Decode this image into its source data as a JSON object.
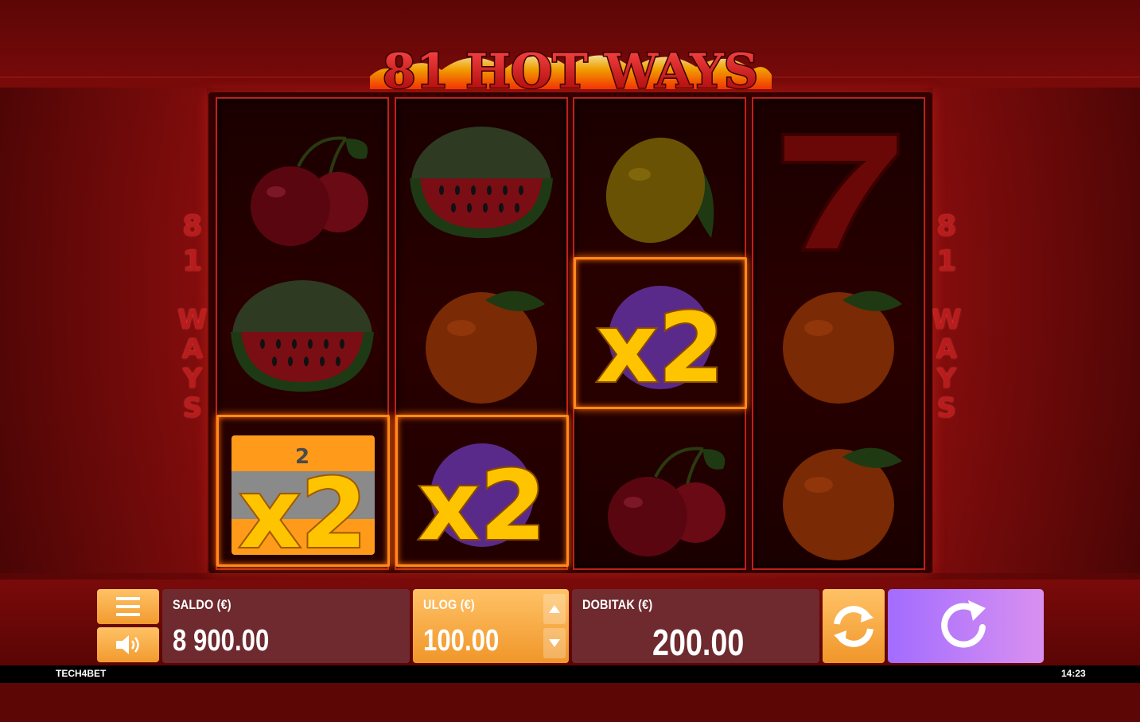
{
  "game": {
    "title": "81 HOT WAYS",
    "side_label_number": [
      "8",
      "1"
    ],
    "side_label_word": [
      "W",
      "A",
      "Y",
      "S"
    ]
  },
  "reels": [
    [
      "cherry",
      "watermelon",
      "x2-multiplier-bar"
    ],
    [
      "watermelon",
      "orange",
      "x2-multiplier-plum"
    ],
    [
      "lemon",
      "x2-multiplier-plum",
      "cherry"
    ],
    [
      "seven",
      "orange",
      "orange"
    ]
  ],
  "multiplier_label": "x2",
  "bar_small_number": "2",
  "controls": {
    "saldo_label": "SALDO (€)",
    "saldo_value": "8 900.00",
    "ulog_label": "ULOG (€)",
    "ulog_value": "100.00",
    "dobitak_label": "DOBITAK (€)",
    "dobitak_value": "200.00"
  },
  "icons": {
    "menu": "hamburger-icon",
    "sound": "speaker-icon",
    "bet_up": "arrow-up-icon",
    "bet_down": "arrow-down-icon",
    "autoplay": "autoplay-icon",
    "spin": "spin-icon"
  },
  "footer": {
    "brand": "TECH4BET",
    "time": "14:23"
  },
  "colors": {
    "background": "#7a0a0a",
    "reel_border": "#c0201a",
    "orange_button": "#f29a2e",
    "spin_button": "#b97cf6",
    "panel": "#6e2a2e"
  }
}
